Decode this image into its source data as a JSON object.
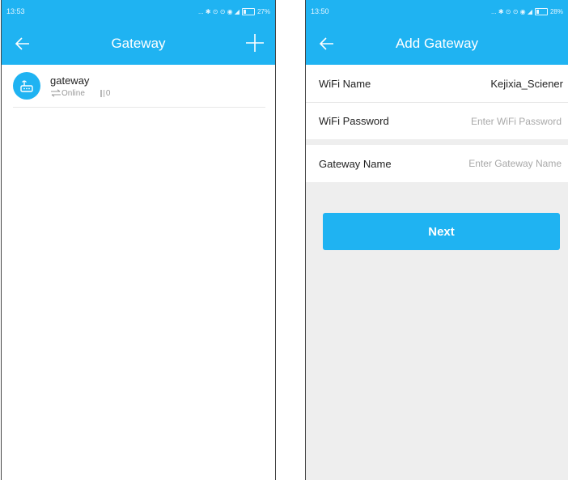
{
  "left_screen": {
    "status_time": "13:53",
    "status_icons": "... ✱ ⊙ ⊙ ◉ ◢",
    "battery_label": "27%",
    "title": "Gateway",
    "gateway": {
      "name": "gateway",
      "status": "Online",
      "device_count": "0"
    }
  },
  "right_screen": {
    "status_time": "13:50",
    "status_icons": "... ✱ ⊙ ⊙ ◉ ◢",
    "battery_label": "28%",
    "title": "Add Gateway",
    "wifi_name_label": "WiFi Name",
    "wifi_name_value": "Kejixia_Sciener",
    "wifi_password_label": "WiFi Password",
    "wifi_password_placeholder": "Enter WiFi Password",
    "gateway_name_label": "Gateway Name",
    "gateway_name_placeholder": "Enter Gateway Name",
    "next_label": "Next"
  },
  "colors": {
    "accent": "#1fb3f2",
    "background": "#eeeeee"
  },
  "icons": [
    "back-arrow-icon",
    "plus-icon",
    "gateway-router-icon",
    "sync-arrows-icon",
    "device-bars-icon"
  ]
}
